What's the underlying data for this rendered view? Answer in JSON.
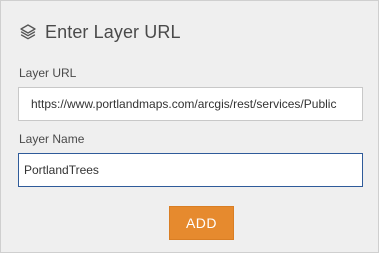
{
  "header": {
    "title": "Enter Layer URL",
    "icon": "layers-icon"
  },
  "form": {
    "url_label": "Layer URL",
    "url_value": "https://www.portlandmaps.com/arcgis/rest/services/Public",
    "name_label": "Layer Name",
    "name_value": "PortlandTrees"
  },
  "actions": {
    "add_label": "ADD"
  },
  "colors": {
    "panel_background": "#efefef",
    "button_accent": "#e68a2e",
    "focus_border": "#2f5b9a"
  }
}
